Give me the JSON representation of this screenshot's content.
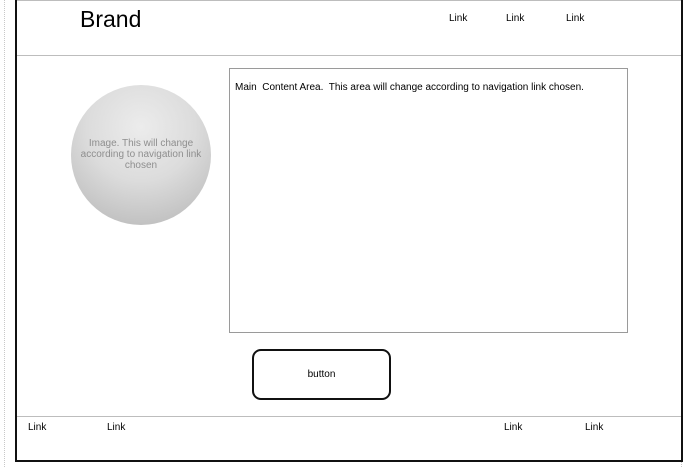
{
  "header": {
    "brand": "Brand",
    "nav_links": [
      "Link",
      "Link",
      "Link"
    ]
  },
  "hero": {
    "caption": "Image.  This will change according to navigation link  chosen"
  },
  "main": {
    "content_text": "Main  Content Area.  This area will change according to navigation link chosen."
  },
  "action": {
    "button_label": "button"
  },
  "footer": {
    "links": [
      "Link",
      "Link",
      "Link",
      "Link"
    ]
  }
}
